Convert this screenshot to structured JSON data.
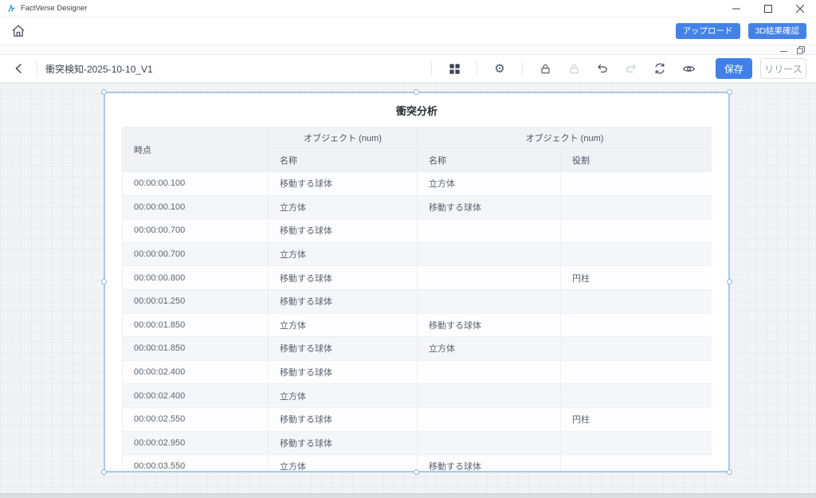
{
  "titlebar": {
    "app_name": "FactVerse Designer"
  },
  "app_header": {
    "upload_button": "アップロード",
    "results_button": "3D結果確認"
  },
  "toolbar": {
    "document_title": "衝突検知-2025-10-10_V1",
    "save_button": "保存",
    "release_button": "リリース"
  },
  "canvas": {
    "widget": {
      "title": "衝突分析",
      "table": {
        "time_header": "時点",
        "object_group_1": "オブジェクト (num)",
        "object_group_2": "オブジェクト (num)",
        "sub_header_name_1": "名称",
        "sub_header_name_2": "名称",
        "sub_header_role": "役割",
        "rows": [
          [
            "00:00:00.100",
            "移動する球体",
            "立方体",
            ""
          ],
          [
            "00:00:00.100",
            "立方体",
            "移動する球体",
            ""
          ],
          [
            "00:00:00.700",
            "移動する球体",
            "",
            ""
          ],
          [
            "00:00:00.700",
            "立方体",
            "",
            ""
          ],
          [
            "00:00:00.800",
            "移動する球体",
            "",
            "円柱"
          ],
          [
            "00:00:01.250",
            "移動する球体",
            "",
            ""
          ],
          [
            "00:00:01.850",
            "立方体",
            "移動する球体",
            ""
          ],
          [
            "00:00:01.850",
            "移動する球体",
            "立方体",
            ""
          ],
          [
            "00:00:02.400",
            "移動する球体",
            "",
            ""
          ],
          [
            "00:00:02.400",
            "立方体",
            "",
            ""
          ],
          [
            "00:00:02.550",
            "移動する球体",
            "",
            "円柱"
          ],
          [
            "00:00:02.950",
            "移動する球体",
            "",
            ""
          ],
          [
            "00:00:03.550",
            "立方体",
            "移動する球体",
            ""
          ]
        ]
      }
    }
  },
  "icons": [
    "app-logo-icon",
    "minimize-icon",
    "maximize-icon",
    "close-icon",
    "home-icon",
    "window-minimize-icon",
    "window-restore-icon",
    "back-icon",
    "blocks-icon",
    "gear-icon",
    "lock-icon",
    "lock-disabled-icon",
    "undo-icon",
    "redo-icon",
    "refresh-icon",
    "eye-icon"
  ],
  "colors": {
    "accent_blue": "#4582e8",
    "save_blue": "#4080e8",
    "selection_blue": "#a8c9ec",
    "header_bg": "#f0f2f6",
    "stripe_bg": "#f5f6f9",
    "canvas_bg": "#f2f3f5"
  }
}
